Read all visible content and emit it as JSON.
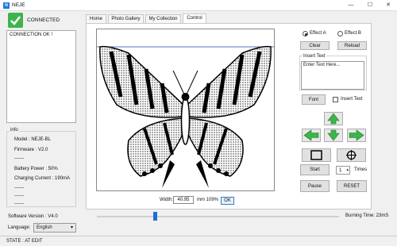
{
  "window": {
    "title": "NEJE",
    "icon_text": "N",
    "minimize": "—",
    "maximize": "☐",
    "close": "✕"
  },
  "connection": {
    "status": "CONNECTED",
    "log": "CONNECTION OK !"
  },
  "info": {
    "title": "info",
    "lines": [
      "Model : NEJE-BL",
      "Firmware : V2.0",
      "------",
      "Battery Power : 50%",
      "Charging Current : 190mA",
      "------",
      "------",
      "------"
    ]
  },
  "software_version": "Software Version : V4.0",
  "language": {
    "label": "Language:",
    "value": "English"
  },
  "tabs": [
    "Home",
    "Photo Gallery",
    "My Collection",
    "Control"
  ],
  "active_tab": "Control",
  "width": {
    "label": "Width:",
    "value": "40.95",
    "unit": "mm 109%",
    "ok": "OK"
  },
  "effects": {
    "a": "Effect A",
    "b": "Effect B",
    "selected": "Effect A"
  },
  "buttons": {
    "clear": "Clear",
    "reload": "Reload",
    "font": "Font",
    "start": "Start",
    "pause": "Pause",
    "reset": "RESET"
  },
  "insert_text": {
    "label": "Insert Text",
    "placeholder": "Enter Text Here...",
    "checkbox": "Insert Text"
  },
  "times": {
    "value": "1",
    "label": "Times"
  },
  "burning_time": "Burning Time: 23mS",
  "slider": {
    "position_fraction": 0.23
  },
  "statusbar": "STATE : AT EDIT",
  "colors": {
    "connected": "#3fb34f",
    "arrows": "#3cb54a",
    "slider": "#1f6fd0"
  }
}
